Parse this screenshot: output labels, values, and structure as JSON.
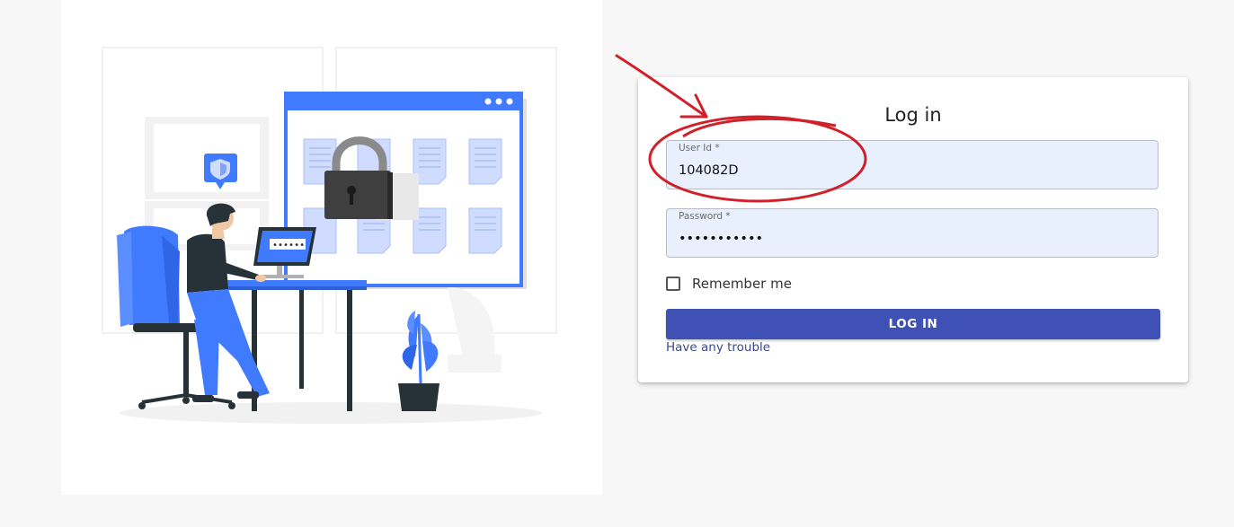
{
  "login": {
    "title": "Log in",
    "user_id_label": "User Id *",
    "user_id_value": "104082D",
    "password_label": "Password *",
    "password_value": "•••••••••••",
    "remember_label": "Remember me",
    "remember_checked": false,
    "button_label": "LOG IN",
    "trouble_link": "Have any trouble"
  },
  "illustration": {
    "screen_dots": "••••••"
  },
  "colors": {
    "accent": "#3f51b5",
    "illustration_blue": "#407bff",
    "annotation_red": "#d0202a",
    "field_background": "#e8f0fe"
  },
  "icons": [
    "padlock-icon",
    "shield-icon",
    "document-icon",
    "checkbox-icon",
    "arrow-annotation",
    "circle-annotation"
  ]
}
